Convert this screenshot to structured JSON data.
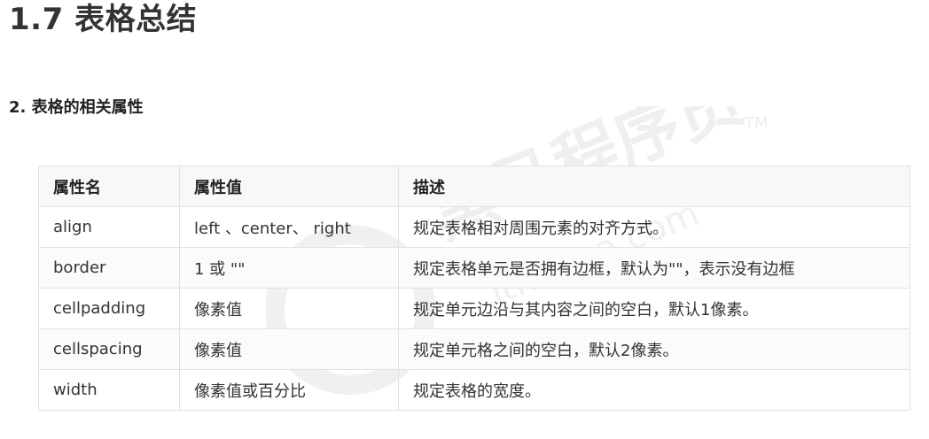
{
  "page": {
    "title": "1.7 表格总结",
    "section_heading": "2. 表格的相关属性"
  },
  "table": {
    "headers": [
      "属性名",
      "属性值",
      "描述"
    ],
    "rows": [
      [
        "align",
        "left 、center、 right",
        "规定表格相对周围元素的对齐方式。"
      ],
      [
        "border",
        "1 或 \"\"",
        "规定表格单元是否拥有边框，默认为\"\"，表示没有边框"
      ],
      [
        "cellpadding",
        "像素值",
        "规定单元边沿与其内容之间的空白，默认1像素。"
      ],
      [
        "cellspacing",
        "像素值",
        "规定单元格之间的空白，默认2像素。"
      ],
      [
        "width",
        "像素值或百分比",
        "规定表格的宽度。"
      ]
    ]
  },
  "watermark": {
    "text_cn": "黑马程序员",
    "text_url": "itheima.com",
    "trademark": "TM",
    "color": "#ebebeb"
  }
}
